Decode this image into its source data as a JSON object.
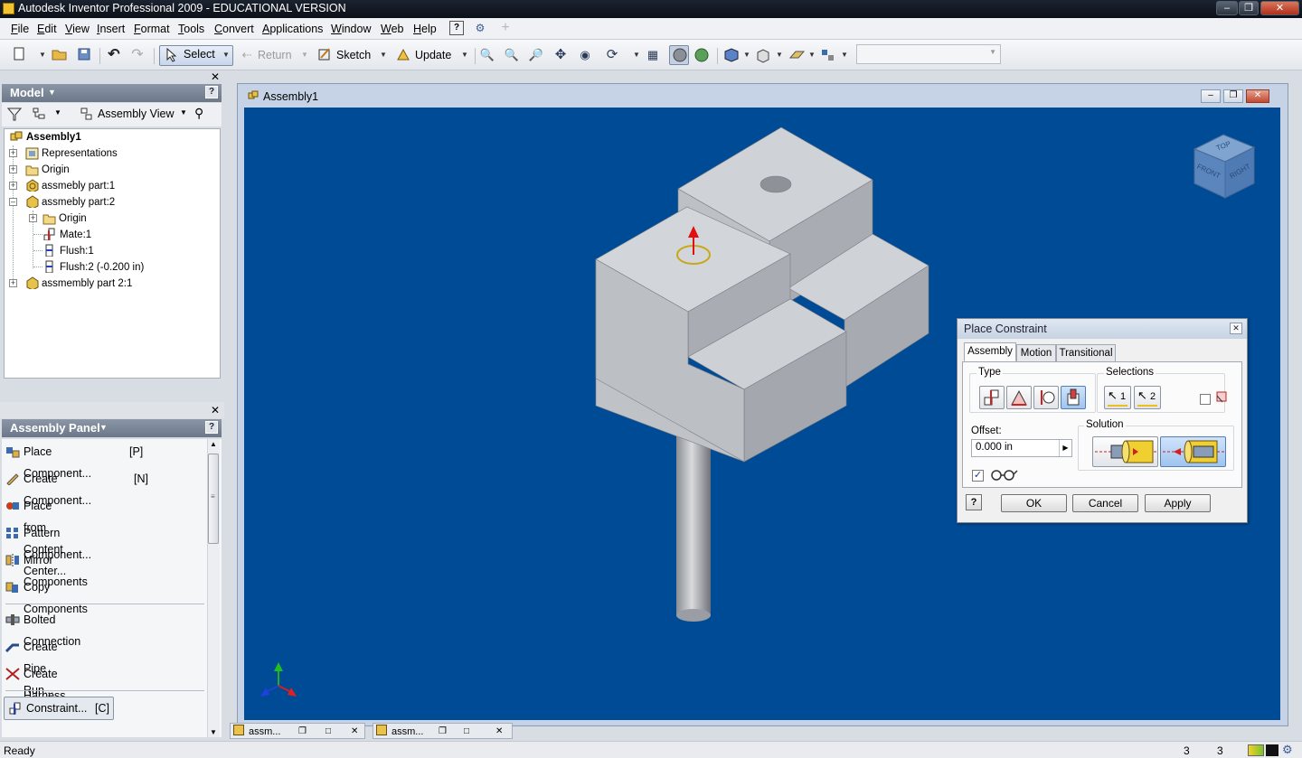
{
  "app": {
    "title": "Autodesk Inventor Professional 2009 - EDUCATIONAL VERSION"
  },
  "menu": [
    "File",
    "Edit",
    "View",
    "Insert",
    "Format",
    "Tools",
    "Convert",
    "Applications",
    "Window",
    "Web",
    "Help"
  ],
  "toolbar": {
    "select": "Select",
    "return": "Return",
    "sketch": "Sketch",
    "update": "Update"
  },
  "browser": {
    "title": "Model",
    "view_filter": "Assembly View",
    "tree": {
      "root": "Assembly1",
      "n1": "Representations",
      "n2": "Origin",
      "n3": "assmebly part:1",
      "n4": "assmebly part:2",
      "n4a": "Origin",
      "n4b": "Mate:1",
      "n4c": "Flush:1",
      "n4d": "Flush:2 (-0.200 in)",
      "n5": "assmembly part 2:1"
    }
  },
  "panel": {
    "title": "Assembly Panel",
    "items": [
      {
        "label": "Place Component...",
        "shortcut": "[P]"
      },
      {
        "label": "Create Component...",
        "shortcut": "[N]"
      },
      {
        "label": "Place from Content Center...",
        "shortcut": ""
      },
      {
        "label": "Pattern Component...",
        "shortcut": ""
      },
      {
        "label": "Mirror Components",
        "shortcut": ""
      },
      {
        "label": "Copy Components",
        "shortcut": ""
      },
      {
        "label": "Bolted Connection",
        "shortcut": ""
      },
      {
        "label": "Create Pipe Run...",
        "shortcut": ""
      },
      {
        "label": "Create Harness...",
        "shortcut": ""
      },
      {
        "label": "Constraint...",
        "shortcut": "[C]"
      }
    ]
  },
  "document": {
    "title": "Assembly1",
    "tabs": [
      "assm...",
      "assm..."
    ],
    "viewcube": {
      "top": "TOP",
      "front": "FRONT",
      "right": "RIGHT"
    }
  },
  "dialog": {
    "title": "Place Constraint",
    "tabs": [
      "Assembly",
      "Motion",
      "Transitional"
    ],
    "type_label": "Type",
    "selections_label": "Selections",
    "sel1": "1",
    "sel2": "2",
    "offset_label": "Offset:",
    "offset_value": "0.000 in",
    "solution_label": "Solution",
    "preview_checked": true,
    "ok": "OK",
    "cancel": "Cancel",
    "apply": "Apply"
  },
  "status": {
    "text": "Ready",
    "count1": "3",
    "count2": "3"
  }
}
